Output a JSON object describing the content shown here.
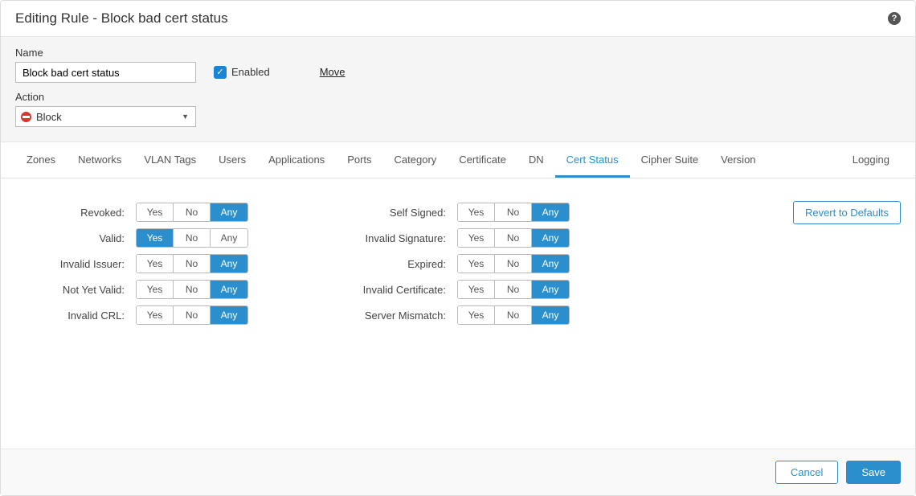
{
  "header": {
    "title": "Editing Rule - Block bad cert status"
  },
  "form": {
    "name_label": "Name",
    "name_value": "Block bad cert status",
    "enabled_label": "Enabled",
    "enabled_checked": true,
    "move_label": "Move",
    "action_label": "Action",
    "action_value": "Block"
  },
  "tabs": {
    "items": [
      {
        "label": "Zones",
        "active": false
      },
      {
        "label": "Networks",
        "active": false
      },
      {
        "label": "VLAN Tags",
        "active": false
      },
      {
        "label": "Users",
        "active": false
      },
      {
        "label": "Applications",
        "active": false
      },
      {
        "label": "Ports",
        "active": false
      },
      {
        "label": "Category",
        "active": false
      },
      {
        "label": "Certificate",
        "active": false
      },
      {
        "label": "DN",
        "active": false
      },
      {
        "label": "Cert Status",
        "active": true
      },
      {
        "label": "Cipher Suite",
        "active": false
      },
      {
        "label": "Version",
        "active": false
      }
    ],
    "right": {
      "label": "Logging",
      "active": false
    }
  },
  "seg_labels": {
    "yes": "Yes",
    "no": "No",
    "any": "Any"
  },
  "status": {
    "left": [
      {
        "label": "Revoked:",
        "sel": "any"
      },
      {
        "label": "Valid:",
        "sel": "yes"
      },
      {
        "label": "Invalid Issuer:",
        "sel": "any"
      },
      {
        "label": "Not Yet Valid:",
        "sel": "any"
      },
      {
        "label": "Invalid CRL:",
        "sel": "any"
      }
    ],
    "right": [
      {
        "label": "Self Signed:",
        "sel": "any"
      },
      {
        "label": "Invalid Signature:",
        "sel": "any"
      },
      {
        "label": "Expired:",
        "sel": "any"
      },
      {
        "label": "Invalid Certificate:",
        "sel": "any"
      },
      {
        "label": "Server Mismatch:",
        "sel": "any"
      }
    ]
  },
  "buttons": {
    "revert": "Revert to Defaults",
    "cancel": "Cancel",
    "save": "Save"
  }
}
